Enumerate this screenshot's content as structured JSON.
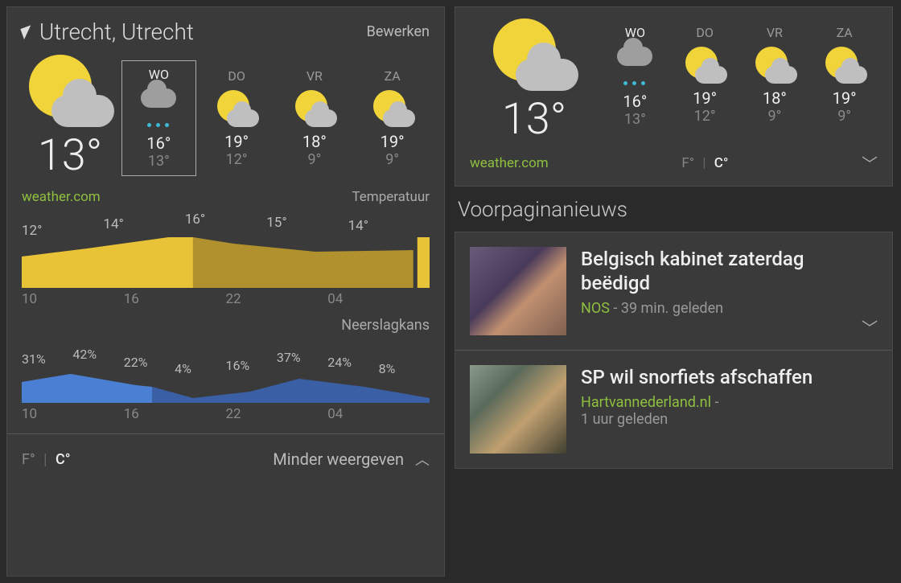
{
  "location": {
    "city": "Utrecht, Utrecht",
    "edit_label": "Bewerken"
  },
  "current": {
    "temp": "13°"
  },
  "forecast": [
    {
      "day": "WO",
      "icon": "rain",
      "hi": "16°",
      "lo": "13°",
      "selected": true
    },
    {
      "day": "DO",
      "icon": "sun-cloud",
      "hi": "19°",
      "lo": "12°",
      "selected": false
    },
    {
      "day": "VR",
      "icon": "sun-cloud",
      "hi": "18°",
      "lo": "9°",
      "selected": false
    },
    {
      "day": "ZA",
      "icon": "sun-cloud",
      "hi": "19°",
      "lo": "9°",
      "selected": false
    }
  ],
  "source_link": "weather.com",
  "temp_label": "Temperatuur",
  "precip_label": "Neerslagkans",
  "units": {
    "f": "F°",
    "c": "C°"
  },
  "collapse_label": "Minder weergeven",
  "chart_data": [
    {
      "type": "area",
      "name": "temperature_hourly",
      "x": [
        "10",
        "16",
        "22",
        "04"
      ],
      "values": [
        12,
        14,
        16,
        15,
        14
      ],
      "value_labels": [
        "12°",
        "14°",
        "16°",
        "15°",
        "14°"
      ],
      "ylim": [
        0,
        20
      ]
    },
    {
      "type": "area",
      "name": "precip_hourly",
      "x": [
        "10",
        "16",
        "22",
        "04"
      ],
      "values": [
        31,
        42,
        22,
        4,
        16,
        37,
        24,
        8
      ],
      "value_labels": [
        "31%",
        "42%",
        "22%",
        "4%",
        "16%",
        "37%",
        "24%",
        "8%"
      ],
      "ylim": [
        0,
        100
      ]
    }
  ],
  "news_header": "Voorpaginanieuws",
  "news": [
    {
      "title": "Belgisch kabinet zaterdag beëdigd",
      "source": "NOS",
      "time": "39 min. geleden",
      "sep": " - "
    },
    {
      "title": "SP wil snorfiets afschaffen",
      "source": "Hartvannederland.nl",
      "time": "1 uur geleden",
      "sep": " - "
    }
  ]
}
